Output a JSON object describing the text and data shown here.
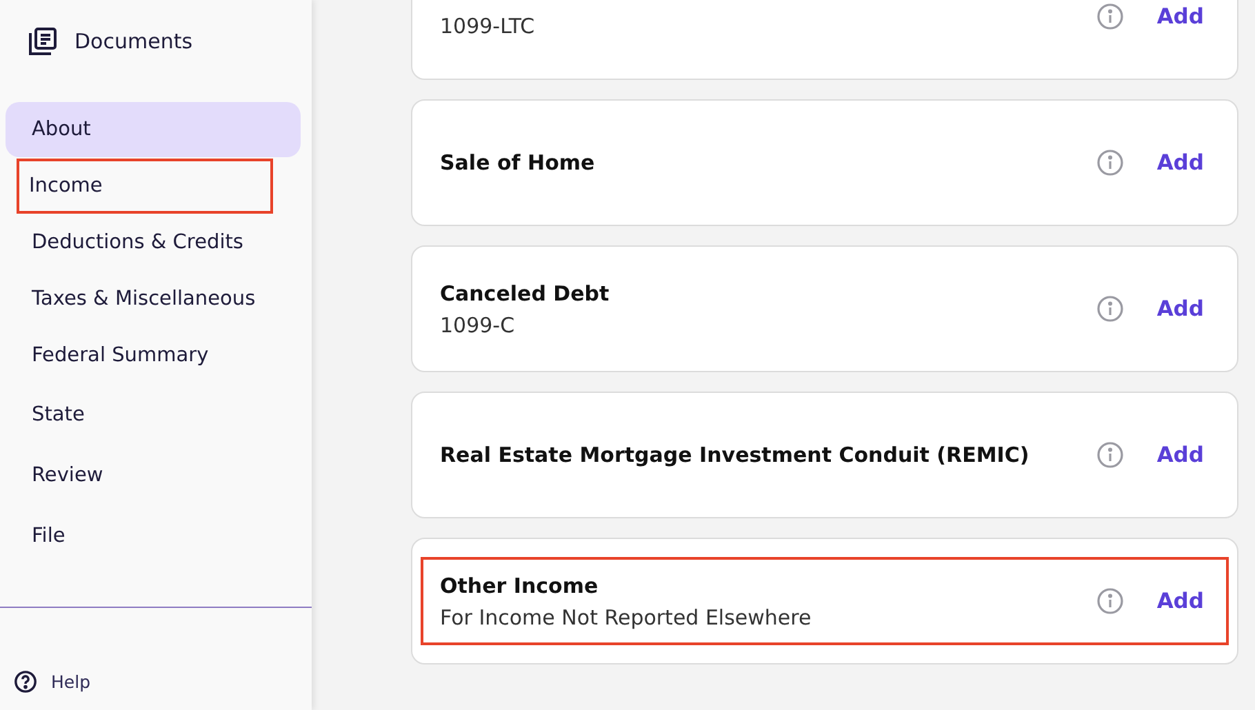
{
  "sidebar": {
    "header": {
      "label": "Documents"
    },
    "items": [
      {
        "label": "About",
        "selected": true,
        "highlighted": false
      },
      {
        "label": "Income",
        "selected": false,
        "highlighted": true
      },
      {
        "label": "Deductions & Credits",
        "selected": false,
        "highlighted": false
      },
      {
        "label": "Taxes & Miscellaneous",
        "selected": false,
        "highlighted": false
      },
      {
        "label": "Federal Summary",
        "selected": false,
        "highlighted": false
      },
      {
        "label": "State",
        "selected": false,
        "highlighted": false
      },
      {
        "label": "Review",
        "selected": false,
        "highlighted": false
      },
      {
        "label": "File",
        "selected": false,
        "highlighted": false
      }
    ],
    "help": {
      "label": "Help"
    }
  },
  "cards": [
    {
      "subtitle": "1099-LTC",
      "action": "Add",
      "highlighted": false
    },
    {
      "title": "Sale of Home",
      "action": "Add",
      "highlighted": false
    },
    {
      "title": "Canceled Debt",
      "subtitle": "1099-C",
      "action": "Add",
      "highlighted": false
    },
    {
      "title": "Real Estate Mortgage Investment Conduit (REMIC)",
      "action": "Add",
      "highlighted": false
    },
    {
      "title": "Other Income",
      "subtitle": "For Income Not Reported Elsewhere",
      "action": "Add",
      "highlighted": true
    }
  ]
}
